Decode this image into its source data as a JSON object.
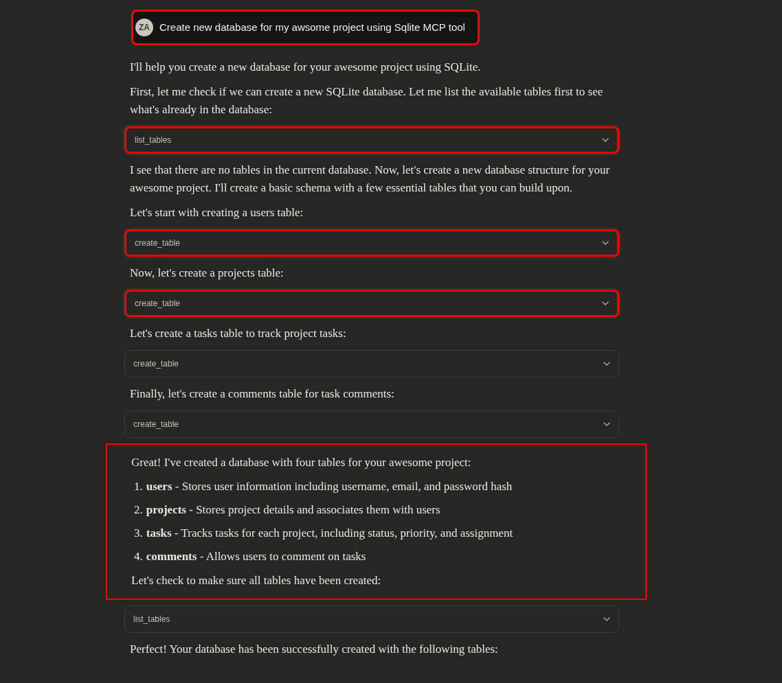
{
  "user_message": {
    "avatar": "ZA",
    "text": "Create new database for my awsome project using Sqlite MCP tool",
    "highlighted": true
  },
  "blocks": [
    {
      "kind": "text",
      "text": "I'll help you create a new database for your awesome project using SQLite."
    },
    {
      "kind": "text",
      "text": "First, let me check if we can create a new SQLite database. Let me list the available tables first to see what's already in the database:"
    },
    {
      "kind": "tool",
      "label": "list_tables",
      "highlighted": true
    },
    {
      "kind": "text",
      "text": "I see that there are no tables in the current database. Now, let's create a new database structure for your awesome project. I'll create a basic schema with a few essential tables that you can build upon."
    },
    {
      "kind": "text",
      "text": "Let's start with creating a users table:"
    },
    {
      "kind": "tool",
      "label": "create_table",
      "highlighted": true
    },
    {
      "kind": "text",
      "text": "Now, let's create a projects table:"
    },
    {
      "kind": "tool",
      "label": "create_table",
      "highlighted": true
    },
    {
      "kind": "text",
      "text": "Let's create a tasks table to track project tasks:"
    },
    {
      "kind": "tool",
      "label": "create_table",
      "highlighted": false
    },
    {
      "kind": "text",
      "text": "Finally, let's create a comments table for task comments:"
    },
    {
      "kind": "tool",
      "label": "create_table",
      "highlighted": false
    },
    {
      "kind": "group",
      "highlighted": true,
      "children": [
        {
          "kind": "text",
          "text": "Great! I've created a database with four tables for your awesome project:"
        },
        {
          "kind": "list",
          "items": [
            {
              "number": "1.",
              "text": "**users** - Stores user information including username, email, and password hash"
            },
            {
              "number": "2.",
              "text": "**projects** - Stores project details and associates them with users"
            },
            {
              "number": "3.",
              "text": "**tasks** - Tracks tasks for each project, including status, priority, and assignment"
            },
            {
              "number": "4.",
              "text": "**comments** - Allows users to comment on tasks"
            }
          ]
        },
        {
          "kind": "text",
          "text": "Let's check to make sure all tables have been created:"
        }
      ]
    },
    {
      "kind": "tool",
      "label": "list_tables",
      "highlighted": false
    },
    {
      "kind": "text",
      "text": "Perfect! Your database has been successfully created with the following tables:"
    }
  ]
}
